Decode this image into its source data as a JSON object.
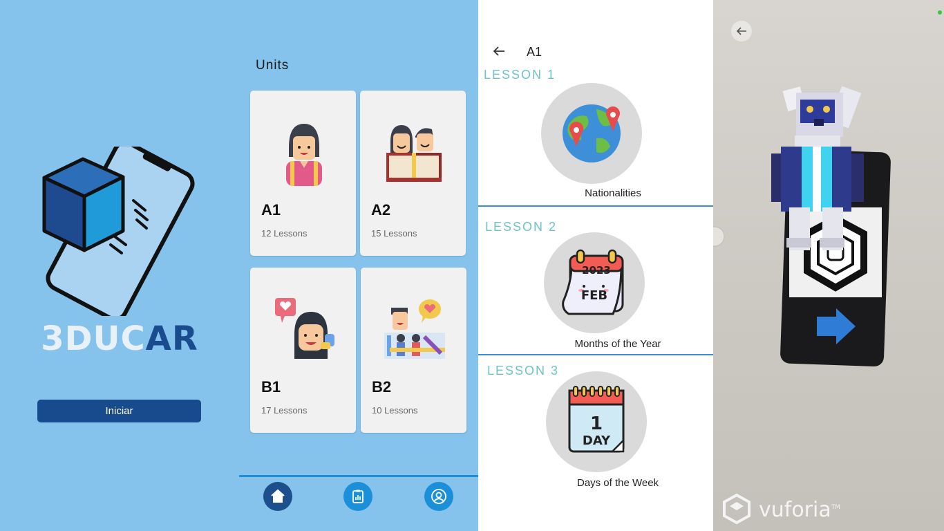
{
  "splash": {
    "logo_text_light": "3DUC",
    "logo_text_dark": "AR",
    "start_button": "Iniciar",
    "colors": {
      "background": "#85C3EC",
      "brand_dark": "#184B8D"
    }
  },
  "units_screen": {
    "title": "Units",
    "cards": [
      {
        "level": "A1",
        "lessons": "12 Lessons",
        "icon": "girl-icon"
      },
      {
        "level": "A2",
        "lessons": "15 Lessons",
        "icon": "reading-book-icon"
      },
      {
        "level": "B1",
        "lessons": "17 Lessons",
        "icon": "girl-speech-heart-icon"
      },
      {
        "level": "B2",
        "lessons": "10 Lessons",
        "icon": "people-heart-icon"
      }
    ],
    "nav": [
      {
        "icon": "home-icon",
        "active": true
      },
      {
        "icon": "report-icon",
        "active": false
      },
      {
        "icon": "profile-icon",
        "active": false
      }
    ]
  },
  "lessons_screen": {
    "title": "A1",
    "lessons": [
      {
        "label": "LESSON 1",
        "name": "Nationalities",
        "icon": "globe-pins-icon"
      },
      {
        "label": "LESSON 2",
        "name": "Months of the Year",
        "icon": "calendar-2023-feb-icon",
        "calendar_year": "2023",
        "calendar_month": "FEB"
      },
      {
        "label": "LESSON 3",
        "name": "Days of the Week",
        "icon": "calendar-1-day-icon",
        "calendar_number": "1",
        "calendar_text": "DAY"
      }
    ],
    "colors": {
      "lesson_label": "#6EC3C9",
      "separator": "#3B8FD0"
    }
  },
  "ar_screen": {
    "watermark": "vuforia",
    "watermark_tm": "TM"
  }
}
